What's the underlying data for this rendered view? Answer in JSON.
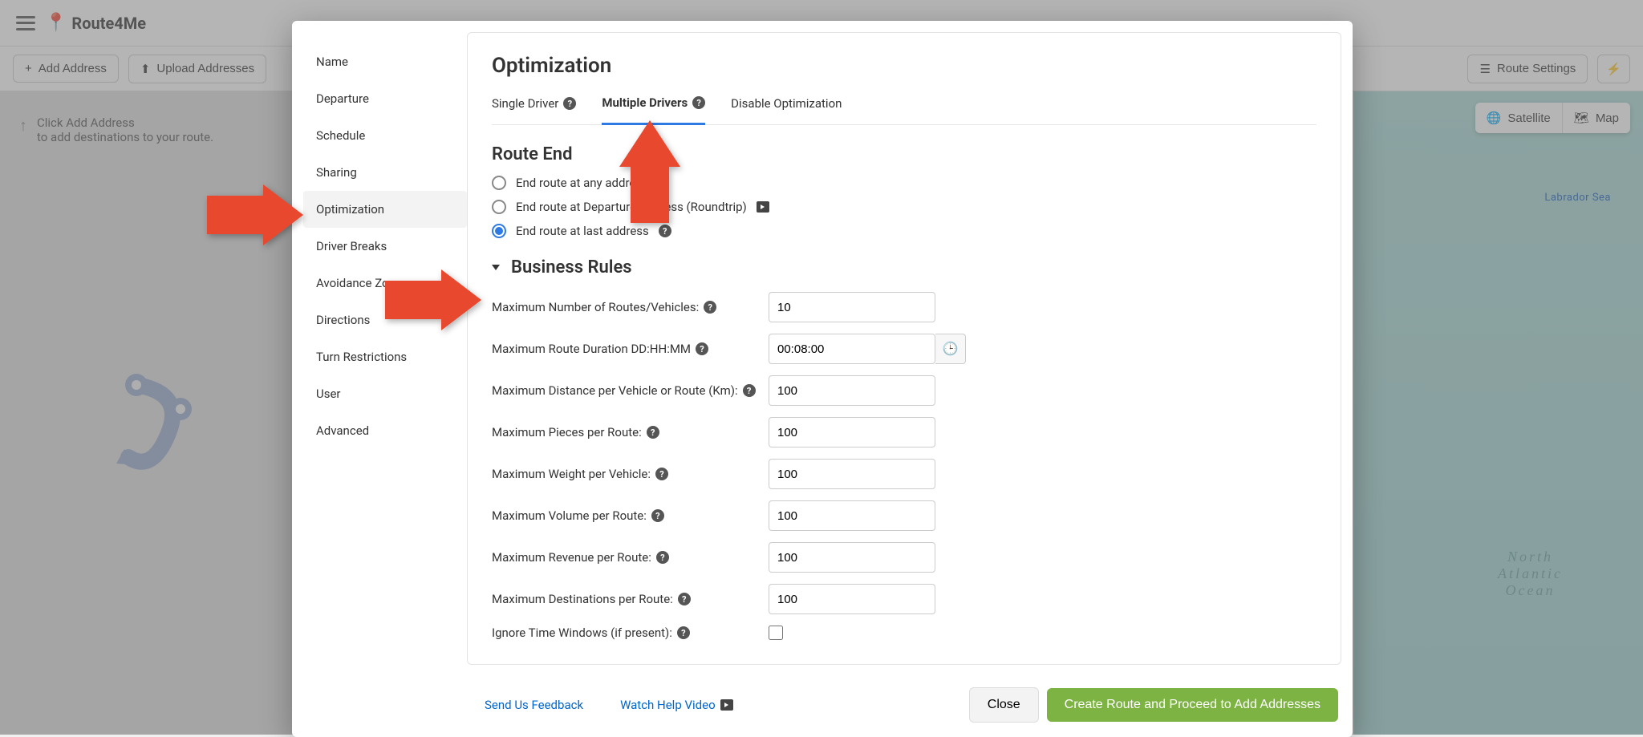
{
  "app": {
    "brand": "Route4Me"
  },
  "toolbar": {
    "add_address": "Add Address",
    "upload_addresses": "Upload Addresses",
    "route_settings": "Route Settings"
  },
  "hint": {
    "line1": "Click Add Address",
    "line2": "to add destinations to your route."
  },
  "map": {
    "satellite": "Satellite",
    "map": "Map",
    "labrador": "Labrador Sea",
    "atlantic1": "North",
    "atlantic2": "Atlantic",
    "atlantic3": "Ocean"
  },
  "sidebar": {
    "items": [
      {
        "label": "Name"
      },
      {
        "label": "Departure"
      },
      {
        "label": "Schedule"
      },
      {
        "label": "Sharing"
      },
      {
        "label": "Optimization"
      },
      {
        "label": "Driver Breaks"
      },
      {
        "label": "Avoidance Zones"
      },
      {
        "label": "Directions"
      },
      {
        "label": "Turn Restrictions"
      },
      {
        "label": "User"
      },
      {
        "label": "Advanced"
      }
    ]
  },
  "panel": {
    "title": "Optimization",
    "tabs": {
      "single": "Single Driver",
      "multiple": "Multiple Drivers",
      "disable": "Disable Optimization"
    },
    "route_end": {
      "title": "Route End",
      "opt_any": "End route at any address",
      "opt_dep": "End route at Departure Address (Roundtrip)",
      "opt_last": "End route at last address"
    },
    "rules": {
      "title": "Business Rules",
      "max_routes": {
        "label": "Maximum Number of Routes/Vehicles:",
        "value": "10"
      },
      "max_duration": {
        "label": "Maximum Route Duration DD:HH:MM",
        "value": "00:08:00"
      },
      "max_distance": {
        "label": "Maximum Distance per Vehicle or Route (Km):",
        "value": "100"
      },
      "max_pieces": {
        "label": "Maximum Pieces per Route:",
        "value": "100"
      },
      "max_weight": {
        "label": "Maximum Weight per Vehicle:",
        "value": "100"
      },
      "max_volume": {
        "label": "Maximum Volume per Route:",
        "value": "100"
      },
      "max_revenue": {
        "label": "Maximum Revenue per Route:",
        "value": "100"
      },
      "max_dest": {
        "label": "Maximum Destinations per Route:",
        "value": "100"
      },
      "ignore_tw": {
        "label": "Ignore Time Windows (if present):"
      }
    }
  },
  "footer": {
    "feedback": "Send Us Feedback",
    "watch_video": "Watch Help Video",
    "close": "Close",
    "proceed": "Create Route and Proceed to Add Addresses"
  }
}
